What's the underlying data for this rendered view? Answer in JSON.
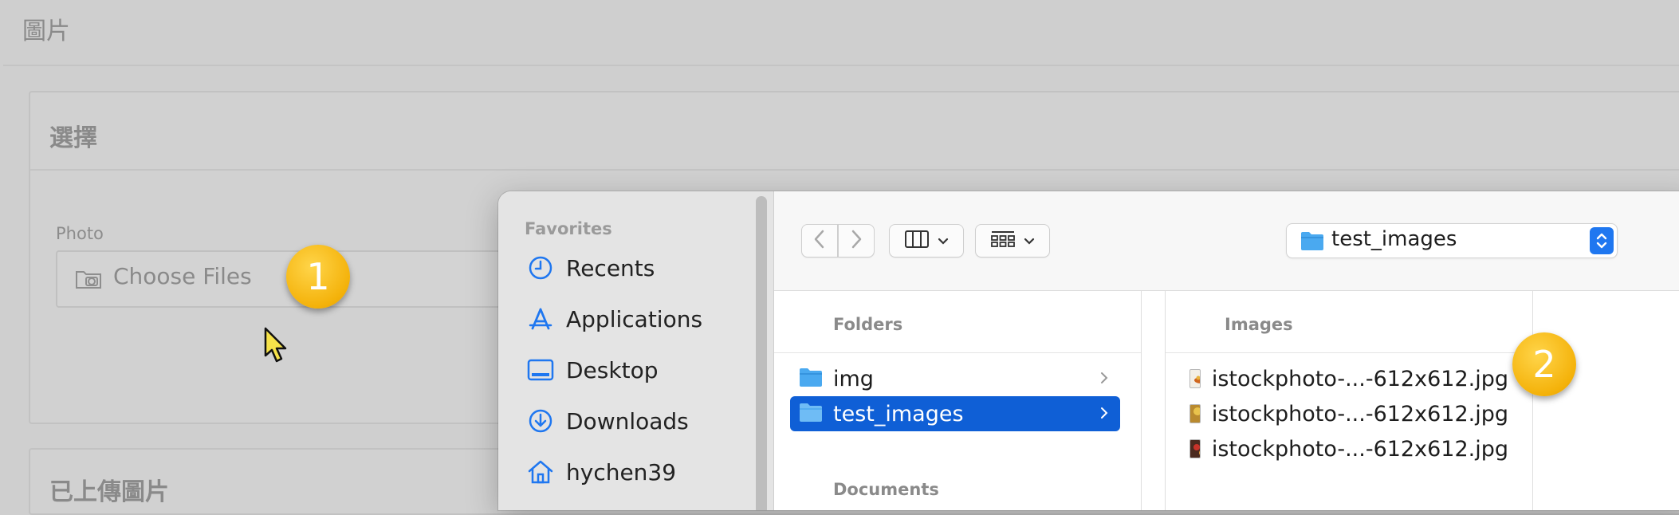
{
  "page": {
    "title": "圖片",
    "select_section_title": "選擇",
    "photo_label": "Photo",
    "choose_files_label": "Choose Files",
    "uploaded_section_title": "已上傳圖片"
  },
  "annotations": {
    "badge_1": "1",
    "badge_2": "2"
  },
  "dialog": {
    "sidebar": {
      "heading": "Favorites",
      "items": [
        {
          "label": "Recents",
          "icon": "clock-icon"
        },
        {
          "label": "Applications",
          "icon": "applications-icon"
        },
        {
          "label": "Desktop",
          "icon": "desktop-icon"
        },
        {
          "label": "Downloads",
          "icon": "downloads-icon"
        },
        {
          "label": "hychen39",
          "icon": "home-icon"
        }
      ]
    },
    "toolbar": {
      "back_icon": "chevron-left-icon",
      "forward_icon": "chevron-right-icon",
      "view_icon": "column-view-icon",
      "group_icon": "grid-group-icon",
      "location": "test_images"
    },
    "folders_column": {
      "header": "Folders",
      "items": [
        {
          "name": "img",
          "selected": false
        },
        {
          "name": "test_images",
          "selected": true
        }
      ],
      "next_header": "Documents"
    },
    "images_column": {
      "header": "Images",
      "items": [
        {
          "name": "istockphoto-...-612x612.jpg"
        },
        {
          "name": "istockphoto-...-612x612.jpg"
        },
        {
          "name": "istockphoto-...-612x612.jpg"
        }
      ]
    }
  },
  "colors": {
    "accent": "#0f5fd6",
    "folder": "#4aa9f0",
    "badge": "#f4b20a"
  }
}
